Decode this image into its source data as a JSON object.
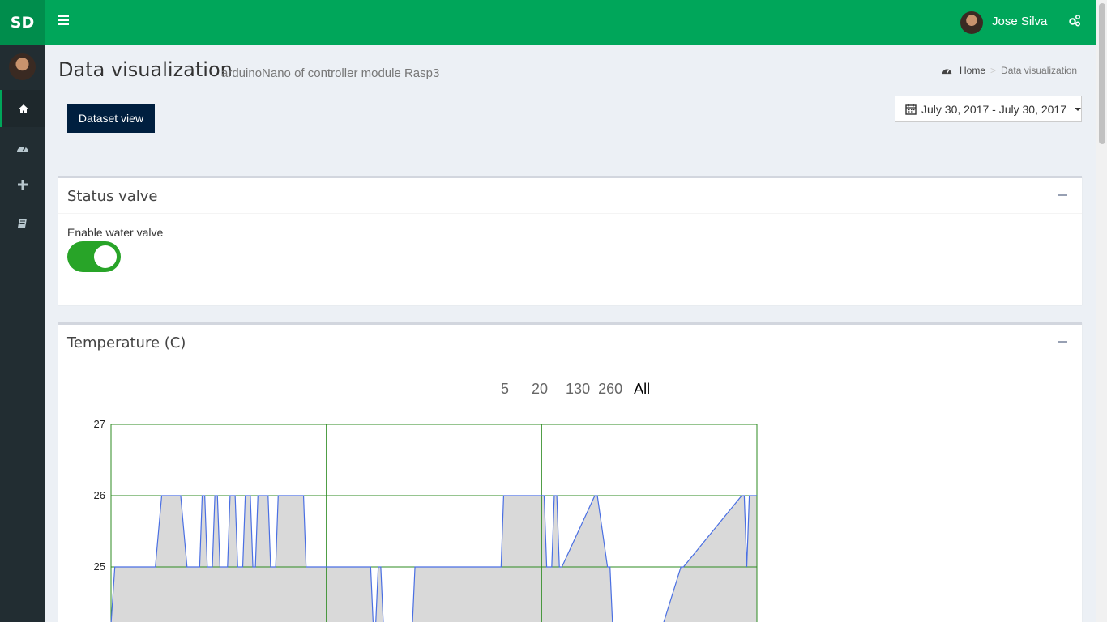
{
  "header": {
    "logo": "SD",
    "user_name": "Jose Silva"
  },
  "sidebar": {
    "items": [
      {
        "icon": "home-icon",
        "active": true
      },
      {
        "icon": "dashboard-icon",
        "active": false
      },
      {
        "icon": "plus-icon",
        "active": false
      },
      {
        "icon": "book-icon",
        "active": false
      }
    ]
  },
  "page": {
    "title": "Data visualization",
    "subtitle": "arduinoNano of controller module Rasp3",
    "breadcrumb": {
      "home": "Home",
      "current": "Data visualization"
    },
    "dataset_button": "Dataset view",
    "date_range": "July 30, 2017 - July 30, 2017"
  },
  "status_box": {
    "title": "Status valve",
    "valve_label": "Enable water valve",
    "valve_enabled": true
  },
  "temperature_box": {
    "title": "Temperature (C)",
    "range_buttons": [
      "5",
      "20",
      "130",
      "260",
      "All"
    ],
    "active_range": "All"
  },
  "colors": {
    "header": "#00a65a",
    "logo_bg": "#008d4c",
    "sidebar": "#222d32",
    "toggle_on": "#28a428",
    "chart_line": "#4a6fe3",
    "chart_fill": "#d9d9d9",
    "chart_grid": "#2e8b22"
  },
  "chart_data": {
    "type": "area",
    "title": "",
    "xlabel": "",
    "ylabel": "",
    "yticks": [
      "27",
      "26",
      "25"
    ],
    "ylim_visible": [
      24.2,
      27
    ],
    "grid": true,
    "series": [
      {
        "x": [
          0,
          0.3,
          3.5,
          4,
          5.5,
          6,
          7,
          7.2,
          7.4,
          7.6,
          8,
          8.2,
          8.4,
          8.6,
          9.2,
          9.4,
          9.8,
          10,
          10.4,
          10.6,
          11,
          11.2,
          11.4,
          11.6,
          12.4,
          12.6,
          13,
          13.2,
          15.2,
          15.4,
          20.5,
          20.7,
          20.9,
          21.1,
          21.3,
          21.5,
          21.7,
          22.1,
          22.3,
          22.5,
          23.8,
          24.0,
          30.8,
          31.0,
          34.2,
          34.4,
          34.8,
          35.0,
          35.2,
          35.4,
          35.6,
          38.2,
          38.4,
          39.2,
          39.4,
          39.6,
          39.8,
          43.4,
          43.6,
          45,
          45.2,
          49.8,
          50,
          50.2,
          50.4,
          51
        ],
        "y": [
          24.2,
          25,
          25,
          26,
          26,
          25,
          25,
          26,
          26,
          25,
          25,
          26,
          26,
          25,
          25,
          26,
          26,
          25,
          25,
          26,
          26,
          25,
          25,
          26,
          26,
          25,
          25,
          26,
          26,
          25,
          25,
          24.2,
          24.2,
          25,
          25,
          24.2,
          24.2,
          24.2,
          24.2,
          24.2,
          24.2,
          25,
          25,
          26,
          26,
          25,
          25,
          26,
          26,
          25,
          25,
          26,
          26,
          25,
          25,
          24.2,
          24.2,
          24.2,
          24.2,
          25,
          25,
          26,
          26,
          25,
          26,
          26
        ]
      }
    ]
  }
}
